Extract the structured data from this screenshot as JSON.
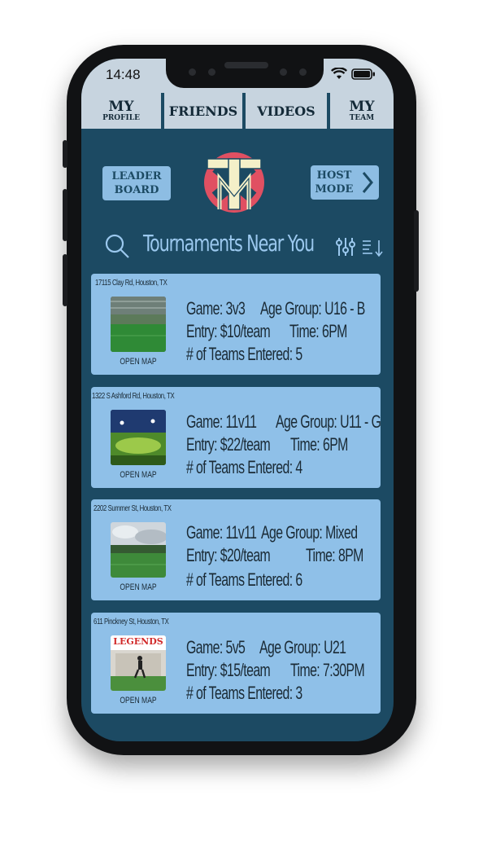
{
  "status_bar": {
    "time": "14:48"
  },
  "tabs": {
    "my_profile": {
      "big": "MY",
      "small": "PROFILE"
    },
    "friends": "FRIENDS",
    "videos": "VIDEOS",
    "my_team": {
      "big": "MY",
      "small": "TEAM"
    }
  },
  "actions": {
    "leaderboard": [
      "LEADER",
      "BOARD"
    ],
    "host_mode": [
      "HOST",
      "MODE"
    ]
  },
  "search": {
    "title": "Tournaments Near You"
  },
  "colors": {
    "screen_bg": "#1c4a63",
    "card_bg": "#8fc0e8",
    "accent_text": "#9bc8ee",
    "logo_red": "#e05062",
    "logo_cream": "#f4f0c8"
  },
  "icons": [
    "wifi-icon",
    "battery-icon",
    "search-icon",
    "filter-sliders-icon",
    "sort-icon",
    "chevron-right-icon"
  ],
  "tournaments": [
    {
      "address": "17115 Clay Rd, Houston, TX",
      "game": "Game: 3v3",
      "age_group": "Age Group: U16 - B",
      "entry": "Entry: $10/team",
      "time": "Time: 6PM",
      "teams": "# of Teams Entered: 5",
      "map_label": "OPEN MAP"
    },
    {
      "address": "1322 S Ashford Rd, Houston, TX",
      "game": "Game: 11v11",
      "age_group": "Age Group: U11 - G",
      "entry": "Entry: $22/team",
      "time": "Time: 6PM",
      "teams": "# of Teams Entered: 4",
      "map_label": "OPEN MAP"
    },
    {
      "address": "2202 Summer St, Houston, TX",
      "game": "Game: 11v11",
      "age_group": "Age Group: Mixed",
      "entry": "Entry: $20/team",
      "time": "Time: 8PM",
      "teams": "# of Teams Entered: 6",
      "map_label": "OPEN MAP"
    },
    {
      "address": "611 Pinckney St, Houston, TX",
      "game": "Game: 5v5",
      "age_group": "Age Group: U21",
      "entry": "Entry: $15/team",
      "time": "Time: 7:30PM",
      "teams": "# of Teams Entered: 3",
      "map_label": "OPEN MAP",
      "photo_sign": "LEGENDS"
    }
  ]
}
